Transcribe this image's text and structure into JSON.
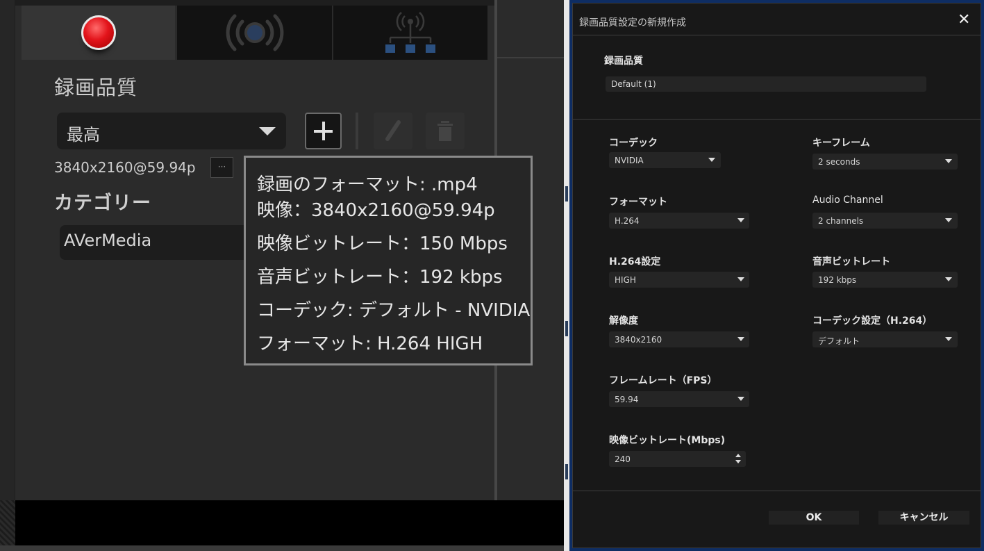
{
  "left_panel": {
    "tabs": [
      {
        "name": "recording",
        "icon": "record-icon"
      },
      {
        "name": "streaming",
        "icon": "broadcast-icon"
      },
      {
        "name": "network",
        "icon": "network-icon"
      }
    ],
    "quality_heading": "録画品質",
    "quality_select_value": "最高",
    "resolution": "3840x2160@59.94p",
    "more_label": "···",
    "category_heading": "カテゴリー",
    "category_value": "AVerMedia",
    "tooltip_lines": [
      "録画のフォーマット: .mp4",
      "映像：3840x2160@59.94p",
      "映像ビットレート：150 Mbps",
      "音声ビットレート：192 kbps",
      "コーデック: デフォルト - NVIDIA",
      "フォーマット: H.264 HIGH"
    ]
  },
  "dialog": {
    "title": "録画品質設定の新規作成",
    "close": "✕",
    "name_label": "録画品質",
    "name_value": "Default (1)",
    "fields": {
      "codec": {
        "label": "コーデック",
        "value": "NVIDIA"
      },
      "keyframe": {
        "label": "キーフレーム",
        "value": "2 seconds"
      },
      "format": {
        "label": "フォーマット",
        "value": "H.264"
      },
      "audio_channel": {
        "label": "Audio Channel",
        "value": "2 channels"
      },
      "h264_setting": {
        "label": "H.264設定",
        "value": "HIGH"
      },
      "audio_bitrate": {
        "label": "音声ビットレート",
        "value": "192 kbps"
      },
      "resolution": {
        "label": "解像度",
        "value": "3840x2160"
      },
      "codec_setting": {
        "label": "コーデック設定（H.264）",
        "value": "デフォルト"
      },
      "framerate": {
        "label": "フレームレート（FPS）",
        "value": "59.94"
      },
      "video_bitrate": {
        "label": "映像ビットレート(Mbps)",
        "value": "240"
      }
    },
    "ok_label": "OK",
    "cancel_label": "キャンセル"
  },
  "colors": {
    "record_red": "#e3141b",
    "dialog_border": "#0e2d63",
    "network_blue": "#3b6fae"
  }
}
